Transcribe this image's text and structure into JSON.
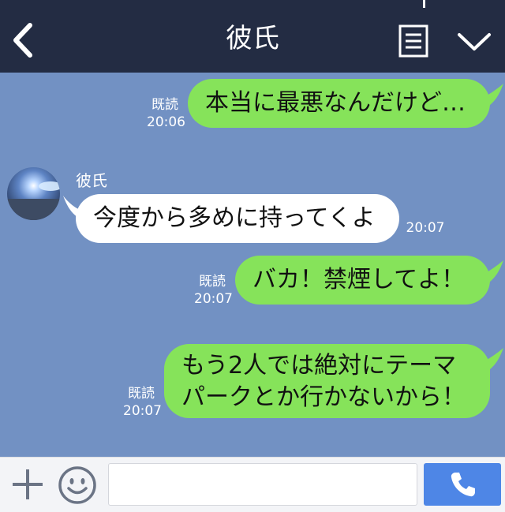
{
  "header": {
    "title": "彼氏",
    "back_icon": "chevron-left-icon",
    "menu_icon": "menu-icon",
    "collapse_icon": "chevron-down-icon",
    "background": "#232c43"
  },
  "chat": {
    "background": "#7291c3",
    "messages": [
      {
        "side": "right",
        "lines": [
          "本当に最悪なんだけど…"
        ],
        "status": "既読",
        "time": "20:06"
      },
      {
        "side": "left",
        "sender": "彼氏",
        "lines": [
          "今度から多めに持ってくよ"
        ],
        "time": "20:07"
      },
      {
        "side": "right",
        "lines": [
          "バカ！禁煙してよ！"
        ],
        "status": "既読",
        "time": "20:07"
      },
      {
        "side": "right",
        "lines": [
          "もう2人では絶対にテーマ",
          "パークとか行かないから！"
        ],
        "status": "既読",
        "time": "20:07"
      }
    ]
  },
  "input_bar": {
    "placeholder": "",
    "add_icon": "plus-icon",
    "emoji_icon": "emoji-icon",
    "call_icon": "phone-icon",
    "call_color": "#4e86e6"
  },
  "colors": {
    "outgoing_bubble": "#86e35a",
    "incoming_bubble": "#ffffff"
  }
}
